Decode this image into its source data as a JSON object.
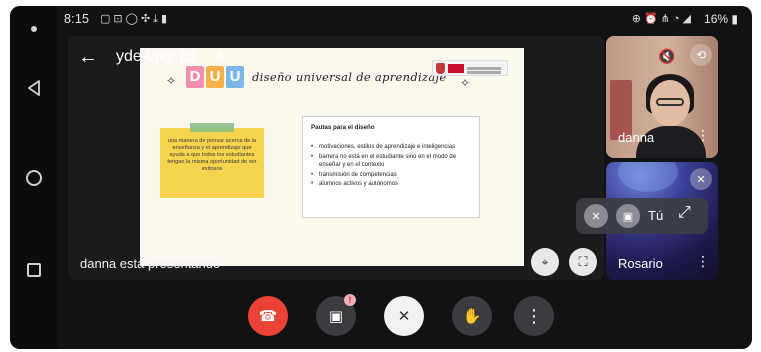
{
  "status_bar": {
    "time": "8:15",
    "left_icons": [
      "notification-icon",
      "gallery-icon",
      "whatsapp-icon",
      "location-icon",
      "download-icon",
      "lock-icon"
    ],
    "right_icons": [
      "vibrate-icon",
      "alarm-icon",
      "network-icon",
      "wifi-icon",
      "signal-icon"
    ],
    "battery_text": "16%"
  },
  "meeting": {
    "code": "yde-vjxy-jct",
    "presenting_text": "danna está presentando"
  },
  "slide": {
    "logo_letters": [
      "D",
      "U",
      "U"
    ],
    "logo_colors": [
      "#f08fb0",
      "#f6b04a",
      "#7ab6e6"
    ],
    "title": "diseño universal de aprendizaje",
    "note_text": "una manera de pensar acerca de la enseñanza y el aprendizaje que ayuda a que todos los estudiantes tengan la misma oportunidad de ser exitosos",
    "panel_title": "Pautas para el diseño",
    "panel_items": [
      "motivaciones, estilos de aprendizaje e inteligencias",
      "barrera no está en el estudiante sino en el modo de enseñar y en el contexto",
      "transmisión de competencias",
      "alumnos activos y autónomos"
    ]
  },
  "participants": [
    {
      "name": "danna"
    },
    {
      "name": "Rosario"
    }
  ],
  "self_view": {
    "label": "Tú"
  },
  "colors": {
    "hangup": "#ea4335",
    "background": "#111214",
    "control": "#3b3c40"
  }
}
